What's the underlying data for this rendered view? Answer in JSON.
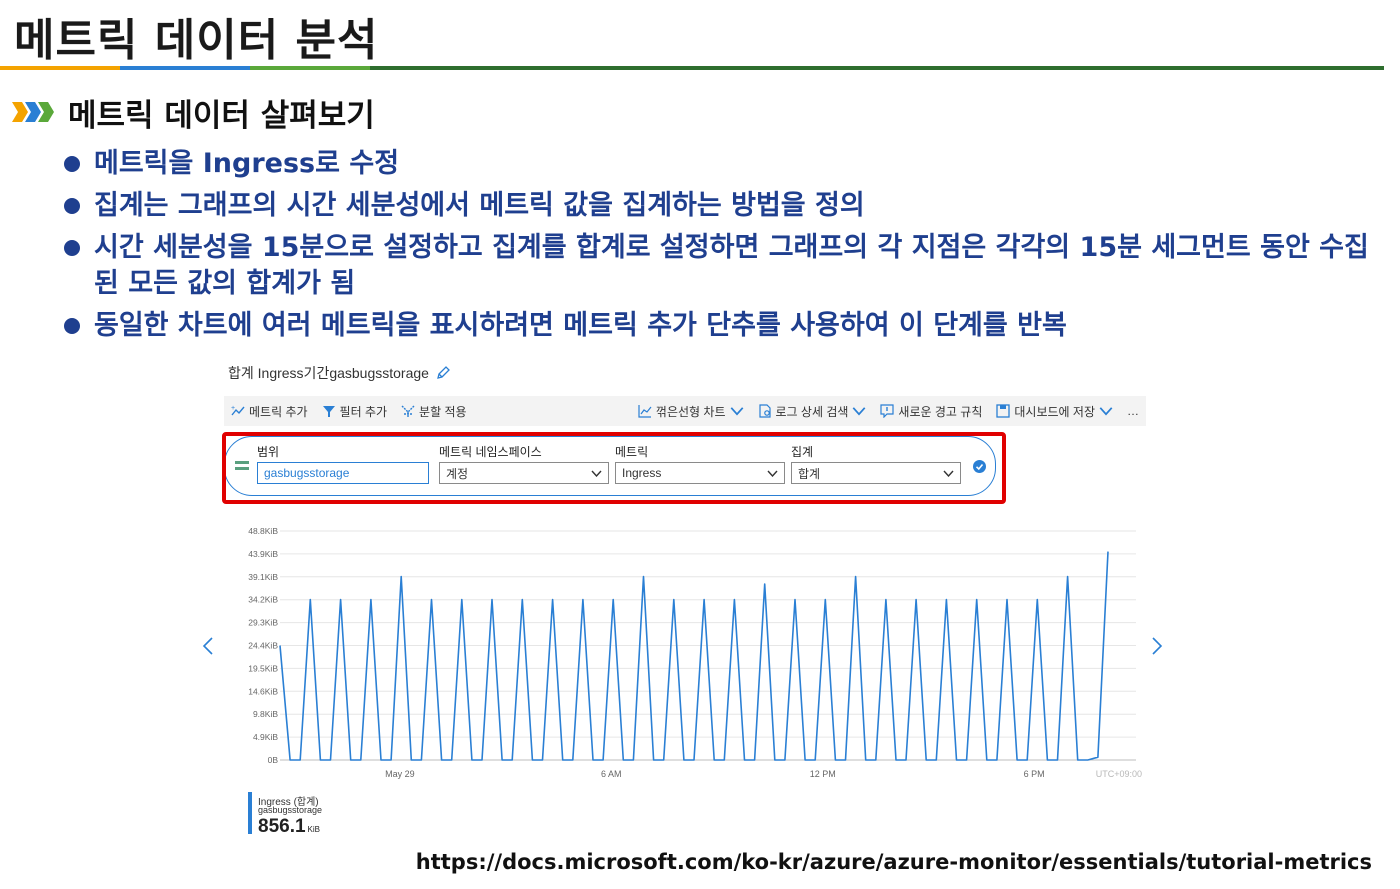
{
  "slide": {
    "title": "메트릭 데이터 분석",
    "section": "메트릭 데이터 살펴보기",
    "bullets": [
      "메트릭을 Ingress로 수정",
      "집계는 그래프의 시간 세분성에서 메트릭 값을 집계하는 방법을 정의",
      "시간 세분성을 15분으로 설정하고 집계를 합계로 설정하면 그래프의 각 지점은 각각의 15분 세그먼트 동안 수집된 모든 값의 합계가 됨",
      "동일한 차트에 여러 메트릭을 표시하려면 메트릭 추가 단추를 사용하여 이 단계를 반복"
    ],
    "source_url": "https://docs.microsoft.com/ko-kr/azure/azure-monitor/essentials/tutorial-metrics"
  },
  "screenshot": {
    "chart_title": "합계 Ingress기간gasbugsstorage",
    "toolbar": {
      "add_metric": "메트릭 추가",
      "add_filter": "필터 추가",
      "apply_split": "분할 적용",
      "line_chart": "꺾은선형 차트",
      "log_search": "로그 상세 검색",
      "new_alert": "새로운 경고 규칙",
      "save_dashboard": "대시보드에 저장",
      "more": "…"
    },
    "filters": {
      "scope_label": "범위",
      "scope_value": "gasbugsstorage",
      "namespace_label": "메트릭 네임스페이스",
      "namespace_value": "계정",
      "metric_label": "메트릭",
      "metric_value": "Ingress",
      "aggregation_label": "집계",
      "aggregation_value": "합계"
    },
    "legend": {
      "name": "Ingress (합계)",
      "resource": "gasbugsstorage",
      "value": "856.1",
      "unit": "KiB"
    },
    "accent_color": "#2a7fd4",
    "highlight_color": "#e00000"
  },
  "chart_data": {
    "type": "line",
    "ylabel": "",
    "xlabel": "",
    "y_ticks": [
      "0B",
      "4.9KiB",
      "9.8KiB",
      "14.6KiB",
      "19.5KiB",
      "24.4KiB",
      "29.3KiB",
      "34.2KiB",
      "39.1KiB",
      "43.9KiB",
      "48.8KiB"
    ],
    "ylim": [
      0,
      48.8
    ],
    "x_ticks": [
      "May 29",
      "6 AM",
      "12 PM",
      "6 PM",
      "UTC+09:00"
    ],
    "grid": true,
    "series": [
      {
        "values": [
          24.4,
          0,
          0,
          34.2,
          0,
          0,
          34.2,
          0,
          0,
          34.2,
          0,
          0,
          39.1,
          0,
          0,
          34.2,
          0,
          0,
          34.2,
          0,
          0,
          34.2,
          0,
          0,
          34.2,
          0,
          0,
          34.2,
          0,
          0,
          34.2,
          0,
          0,
          34.2,
          0,
          0,
          39.1,
          0,
          0,
          34.2,
          0,
          0,
          34.2,
          0,
          0,
          34.2,
          0,
          0,
          37.5,
          0,
          0,
          34.2,
          0,
          0,
          34.2,
          0,
          0,
          39.1,
          0,
          0,
          34.2,
          0,
          0,
          34.2,
          0,
          0,
          34.2,
          0,
          0,
          34.2,
          0,
          0,
          34.2,
          0,
          0,
          34.2,
          0,
          0,
          39.1,
          0,
          0,
          0.6,
          44.4
        ]
      }
    ]
  }
}
